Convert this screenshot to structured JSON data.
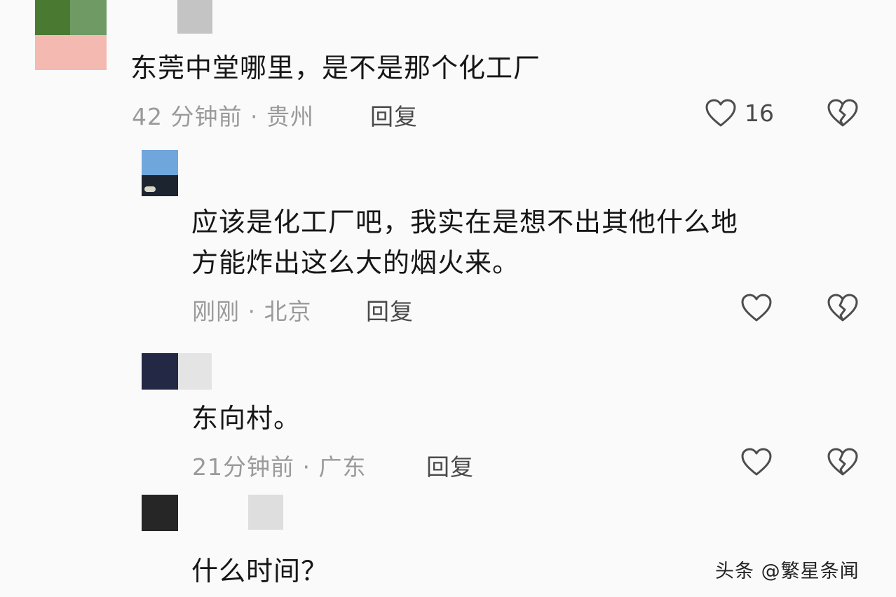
{
  "comments": [
    {
      "text_lines": [
        "东莞中堂哪里，是不是那个化工厂"
      ],
      "time": "42 分钟前",
      "sep": "·",
      "location": "贵州",
      "reply_label": "回复",
      "like_count": "16",
      "like_icon": "heart-outline-icon",
      "dislike_icon": "broken-heart-icon"
    },
    {
      "text_lines": [
        "应该是化工厂吧，我实在是想不出其他什么地",
        "方能炸出这么大的烟火来。"
      ],
      "time": "刚刚",
      "sep": "·",
      "location": "北京",
      "reply_label": "回复",
      "like_count": "",
      "like_icon": "heart-outline-icon",
      "dislike_icon": "broken-heart-icon"
    },
    {
      "text_lines": [
        "东向村。"
      ],
      "time": "21分钟前",
      "sep": "·",
      "location": "广东",
      "reply_label": "回复",
      "like_count": "",
      "like_icon": "heart-outline-icon",
      "dislike_icon": "broken-heart-icon"
    },
    {
      "text_lines": [
        "什么时间？"
      ]
    }
  ],
  "watermark": {
    "prefix": "头条",
    "handle": "@繁星条闻"
  },
  "colors": {
    "background": "#fafafa",
    "text": "#161616",
    "meta": "#9a9a9a",
    "icon": "#555555"
  }
}
